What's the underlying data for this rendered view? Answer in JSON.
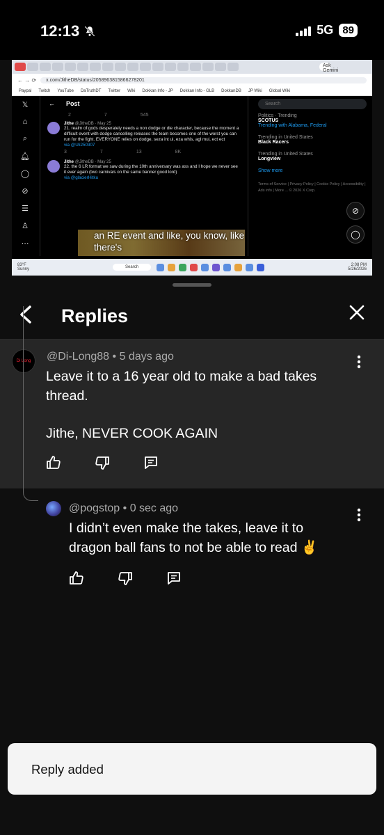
{
  "status_bar": {
    "time": "12:13",
    "network": "5G",
    "battery": "89"
  },
  "video": {
    "gemini": "Ask Gemini",
    "url": "x.com/JitheDB/status/2058963815866278201",
    "bookmarks": [
      "Paypal",
      "Twitch",
      "YouTube",
      "DaTruthDT",
      "Twitter",
      "Wiki",
      "Dokkan Info - JP",
      "Dokkan Info - GLB",
      "DokkanDB",
      "JP Wiki",
      "Global Wiki"
    ],
    "post_header": "Post",
    "stats_top": [
      "2",
      "7",
      "545"
    ],
    "tweet1": {
      "name": "Jithe",
      "handle": "@JitheDB · May 25",
      "text": "21. realm of gods desperately needs a non dodge or die character, because the moment a difficult event with dodge cancelling releases the team becomes one of the worst you can run for the fight. EVERYONE relies on dodge, seza int ui, eza whis, agl mui, ect ect",
      "via": "via @Uli250307",
      "stats": [
        "3",
        "7",
        "13",
        "8K"
      ]
    },
    "tweet2": {
      "name": "Jithe",
      "handle": "@JitheDB · May 25",
      "text": "22. the 6 LR format we saw during the 10th anniversary was ass and I hope we never see it ever again (two carnivals on the same banner good lord)",
      "via": "via @glacierHitku"
    },
    "search_placeholder": "Search",
    "trends": [
      {
        "top": "Politics · Trending",
        "name": "SCOTUS",
        "sub": "Trending with Alabama, Federal"
      },
      {
        "top": "Trending in United States",
        "name": "Black Racers",
        "sub": ""
      },
      {
        "top": "Trending in United States",
        "name": "Longview",
        "sub": ""
      }
    ],
    "show_more": "Show more",
    "footer": "Terms of Service | Privacy Policy | Cookie Policy | Accessibility | Ads info | More ... © 2026 X Corp.",
    "caption_line1": "an RE event and like, you know, like",
    "caption_line2": "there's",
    "taskbar": {
      "temp": "83°F",
      "weather": "Sunny",
      "search": "Search",
      "time": "2:08 PM",
      "date": "5/26/2026"
    }
  },
  "replies": {
    "title": "Replies",
    "parent": {
      "handle": "@Di-Long88",
      "time": "5 days ago",
      "text_line1": "Leave it to a 16 year old to make a bad takes",
      "text_line2": "thread.",
      "text_line3": "Jithe, NEVER COOK AGAIN",
      "avatar_text": "Di Long"
    },
    "reply": {
      "handle": "@pogstop",
      "time": "0 sec ago",
      "text_line1": "I didn’t even make the takes, leave it to",
      "text_line2": "dragon ball fans to not be able to read ✌️"
    }
  },
  "toast": {
    "message": "Reply added"
  }
}
